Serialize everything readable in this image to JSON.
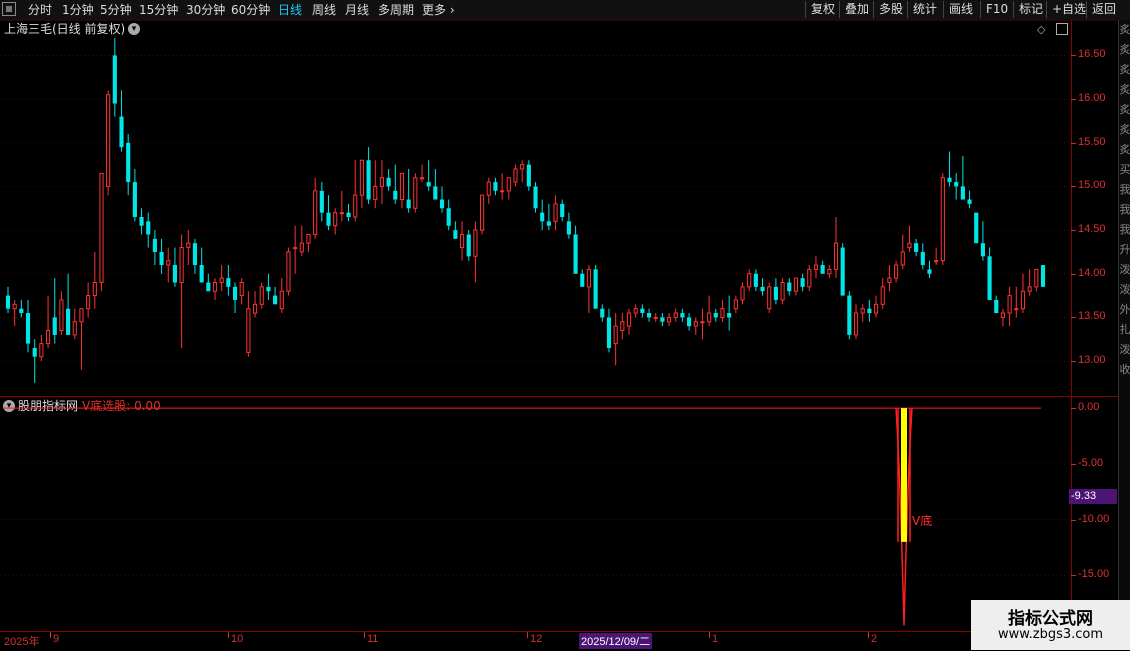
{
  "toolbar": {
    "periods": [
      "分时",
      "1分钟",
      "5分钟",
      "15分钟",
      "30分钟",
      "60分钟",
      "日线",
      "周线",
      "月线",
      "多周期",
      "更多"
    ],
    "active_period": "日线",
    "tools": [
      "复权",
      "叠加",
      "多股",
      "统计",
      "画线",
      "F10",
      "标记",
      "+自选",
      "返回"
    ]
  },
  "main_chart": {
    "title": "上海三毛(日线 前复权)",
    "y_labels": [
      "16.50",
      "16.00",
      "15.50",
      "15.00",
      "14.50",
      "14.00",
      "13.50",
      "13.00"
    ]
  },
  "sidebar_chars": [
    "炙",
    "炙",
    "炙",
    "炙",
    "炙",
    "炙",
    "炙",
    "买",
    "我",
    "我",
    "我",
    "升",
    "泼",
    "泼",
    "外",
    "扎",
    "泼",
    "收"
  ],
  "indicator": {
    "name": "股朋指标网",
    "series_label": "V底选股: 0.00",
    "y_labels": [
      "0.00",
      "-5.00",
      "-10.00",
      "-15.00"
    ],
    "current_badge": "-9.33",
    "annotation": "V底"
  },
  "x_axis": {
    "labels": [
      "2025年",
      "9",
      "10",
      "11",
      "12",
      "2025/12/09/二",
      "1",
      "2"
    ],
    "selected": "2025/12/09/二"
  },
  "watermark": {
    "line1": "指标公式网",
    "line2": "www.zbgs3.com"
  },
  "colors": {
    "up": "#ff3232",
    "down": "#00e5e5",
    "grid": "#5a0000",
    "indicator_line": "#ff2020",
    "indicator_fill": "#ffff00"
  },
  "chart_data": {
    "type": "candlestick",
    "ylim": [
      12.6,
      16.7
    ],
    "indicator_ylim": [
      -20,
      1
    ],
    "candles": [
      [
        13.75,
        13.85,
        13.55,
        13.6
      ],
      [
        13.6,
        13.7,
        13.4,
        13.65
      ],
      [
        13.6,
        13.7,
        13.5,
        13.55
      ],
      [
        13.55,
        13.7,
        13.1,
        13.2
      ],
      [
        13.15,
        13.25,
        12.75,
        13.05
      ],
      [
        13.05,
        13.3,
        13.0,
        13.2
      ],
      [
        13.2,
        13.75,
        13.15,
        13.35
      ],
      [
        13.5,
        13.95,
        13.2,
        13.3
      ],
      [
        13.35,
        13.8,
        13.3,
        13.7
      ],
      [
        13.6,
        14.0,
        13.3,
        13.3
      ],
      [
        13.3,
        13.6,
        13.25,
        13.45
      ],
      [
        13.45,
        13.6,
        12.9,
        13.6
      ],
      [
        13.6,
        13.9,
        13.5,
        13.75
      ],
      [
        13.75,
        14.25,
        13.6,
        13.9
      ],
      [
        13.9,
        15.15,
        13.8,
        15.15
      ],
      [
        15.0,
        16.1,
        14.9,
        16.05
      ],
      [
        16.5,
        16.7,
        15.8,
        15.95
      ],
      [
        15.8,
        16.1,
        15.4,
        15.45
      ],
      [
        15.5,
        15.6,
        14.9,
        15.05
      ],
      [
        15.05,
        15.2,
        14.6,
        14.65
      ],
      [
        14.65,
        14.75,
        14.45,
        14.55
      ],
      [
        14.6,
        14.7,
        14.3,
        14.45
      ],
      [
        14.4,
        14.5,
        14.1,
        14.25
      ],
      [
        14.25,
        14.4,
        14.0,
        14.1
      ],
      [
        14.1,
        14.3,
        13.9,
        14.15
      ],
      [
        14.1,
        14.3,
        13.85,
        13.9
      ],
      [
        13.9,
        14.45,
        13.15,
        14.3
      ],
      [
        14.3,
        14.5,
        14.1,
        14.35
      ],
      [
        14.35,
        14.4,
        14.0,
        14.1
      ],
      [
        14.1,
        14.3,
        13.9,
        13.9
      ],
      [
        13.9,
        14.0,
        13.8,
        13.8
      ],
      [
        13.8,
        13.95,
        13.7,
        13.9
      ],
      [
        13.9,
        14.1,
        13.8,
        13.95
      ],
      [
        13.95,
        14.1,
        13.75,
        13.85
      ],
      [
        13.85,
        13.9,
        13.55,
        13.7
      ],
      [
        13.75,
        13.95,
        13.65,
        13.9
      ],
      [
        13.1,
        13.8,
        13.05,
        13.6
      ],
      [
        13.55,
        13.8,
        13.5,
        13.65
      ],
      [
        13.65,
        13.9,
        13.6,
        13.85
      ],
      [
        13.85,
        14.0,
        13.7,
        13.8
      ],
      [
        13.75,
        13.85,
        13.65,
        13.65
      ],
      [
        13.6,
        13.95,
        13.55,
        13.8
      ],
      [
        13.8,
        14.3,
        13.75,
        14.25
      ],
      [
        14.3,
        14.55,
        14.0,
        14.3
      ],
      [
        14.25,
        14.55,
        14.2,
        14.35
      ],
      [
        14.35,
        14.45,
        14.25,
        14.45
      ],
      [
        14.45,
        15.1,
        14.4,
        14.95
      ],
      [
        14.95,
        15.05,
        14.6,
        14.7
      ],
      [
        14.7,
        14.9,
        14.5,
        14.55
      ],
      [
        14.55,
        14.75,
        14.45,
        14.7
      ],
      [
        14.7,
        14.95,
        14.6,
        14.7
      ],
      [
        14.7,
        14.8,
        14.6,
        14.65
      ],
      [
        14.65,
        15.3,
        14.6,
        14.9
      ],
      [
        14.9,
        15.3,
        14.75,
        15.3
      ],
      [
        15.3,
        15.45,
        14.8,
        14.85
      ],
      [
        14.85,
        15.3,
        14.75,
        15.0
      ],
      [
        15.0,
        15.3,
        14.8,
        15.1
      ],
      [
        15.1,
        15.2,
        14.95,
        15.0
      ],
      [
        14.95,
        15.25,
        14.8,
        14.85
      ],
      [
        14.85,
        15.15,
        14.75,
        15.15
      ],
      [
        14.85,
        15.2,
        14.7,
        14.75
      ],
      [
        14.75,
        15.15,
        14.7,
        15.1
      ],
      [
        15.1,
        15.25,
        15.05,
        15.1
      ],
      [
        15.05,
        15.3,
        14.95,
        15.0
      ],
      [
        15.0,
        15.2,
        14.85,
        14.85
      ],
      [
        14.85,
        15.0,
        14.7,
        14.75
      ],
      [
        14.75,
        14.85,
        14.5,
        14.55
      ],
      [
        14.5,
        14.6,
        14.4,
        14.4
      ],
      [
        14.3,
        14.6,
        14.15,
        14.45
      ],
      [
        14.45,
        14.5,
        14.15,
        14.2
      ],
      [
        14.2,
        14.6,
        13.9,
        14.5
      ],
      [
        14.5,
        14.9,
        14.45,
        14.9
      ],
      [
        14.9,
        15.1,
        14.8,
        15.05
      ],
      [
        15.05,
        15.1,
        14.9,
        14.95
      ],
      [
        14.95,
        15.15,
        14.85,
        14.95
      ],
      [
        14.95,
        15.1,
        14.85,
        15.1
      ],
      [
        15.05,
        15.25,
        15.0,
        15.2
      ],
      [
        15.2,
        15.3,
        15.05,
        15.25
      ],
      [
        15.25,
        15.3,
        14.95,
        15.0
      ],
      [
        15.0,
        15.05,
        14.7,
        14.75
      ],
      [
        14.7,
        14.85,
        14.5,
        14.6
      ],
      [
        14.6,
        14.8,
        14.5,
        14.55
      ],
      [
        14.6,
        14.9,
        14.5,
        14.8
      ],
      [
        14.8,
        14.85,
        14.6,
        14.65
      ],
      [
        14.6,
        14.7,
        14.4,
        14.45
      ],
      [
        14.45,
        14.55,
        14.0,
        14.0
      ],
      [
        14.0,
        14.05,
        13.85,
        13.85
      ],
      [
        13.85,
        14.1,
        13.55,
        14.05
      ],
      [
        14.05,
        14.1,
        13.6,
        13.6
      ],
      [
        13.6,
        13.65,
        13.45,
        13.5
      ],
      [
        13.5,
        13.6,
        13.1,
        13.15
      ],
      [
        13.2,
        13.55,
        12.95,
        13.4
      ],
      [
        13.35,
        13.55,
        13.25,
        13.45
      ],
      [
        13.4,
        13.6,
        13.3,
        13.55
      ],
      [
        13.55,
        13.65,
        13.5,
        13.6
      ],
      [
        13.6,
        13.65,
        13.5,
        13.55
      ],
      [
        13.55,
        13.6,
        13.45,
        13.5
      ],
      [
        13.5,
        13.55,
        13.45,
        13.5
      ],
      [
        13.5,
        13.55,
        13.4,
        13.45
      ],
      [
        13.45,
        13.55,
        13.4,
        13.5
      ],
      [
        13.5,
        13.6,
        13.45,
        13.55
      ],
      [
        13.55,
        13.6,
        13.45,
        13.5
      ],
      [
        13.5,
        13.55,
        13.35,
        13.4
      ],
      [
        13.4,
        13.5,
        13.3,
        13.45
      ],
      [
        13.45,
        13.6,
        13.25,
        13.45
      ],
      [
        13.45,
        13.75,
        13.4,
        13.55
      ],
      [
        13.55,
        13.6,
        13.45,
        13.5
      ],
      [
        13.5,
        13.7,
        13.45,
        13.6
      ],
      [
        13.55,
        13.75,
        13.35,
        13.5
      ],
      [
        13.6,
        13.75,
        13.55,
        13.7
      ],
      [
        13.7,
        13.9,
        13.65,
        13.85
      ],
      [
        13.85,
        14.05,
        13.8,
        14.0
      ],
      [
        14.0,
        14.05,
        13.8,
        13.85
      ],
      [
        13.85,
        13.95,
        13.75,
        13.8
      ],
      [
        13.6,
        13.9,
        13.55,
        13.85
      ],
      [
        13.85,
        13.95,
        13.65,
        13.7
      ],
      [
        13.7,
        13.95,
        13.65,
        13.9
      ],
      [
        13.9,
        13.95,
        13.75,
        13.8
      ],
      [
        13.8,
        13.95,
        13.75,
        13.95
      ],
      [
        13.95,
        14.0,
        13.8,
        13.85
      ],
      [
        13.85,
        14.1,
        13.8,
        14.05
      ],
      [
        14.05,
        14.2,
        13.95,
        14.1
      ],
      [
        14.1,
        14.15,
        14.0,
        14.0
      ],
      [
        14.0,
        14.1,
        13.95,
        14.05
      ],
      [
        14.05,
        14.65,
        13.95,
        14.35
      ],
      [
        14.3,
        14.35,
        13.75,
        13.75
      ],
      [
        13.75,
        13.8,
        13.25,
        13.3
      ],
      [
        13.3,
        13.65,
        13.25,
        13.55
      ],
      [
        13.55,
        13.65,
        13.45,
        13.6
      ],
      [
        13.6,
        13.7,
        13.45,
        13.55
      ],
      [
        13.55,
        13.75,
        13.5,
        13.65
      ],
      [
        13.65,
        13.95,
        13.6,
        13.85
      ],
      [
        13.9,
        14.1,
        13.8,
        13.95
      ],
      [
        13.95,
        14.15,
        13.9,
        14.1
      ],
      [
        14.1,
        14.45,
        14.05,
        14.25
      ],
      [
        14.3,
        14.55,
        14.25,
        14.35
      ],
      [
        14.35,
        14.4,
        14.2,
        14.25
      ],
      [
        14.25,
        14.35,
        14.05,
        14.1
      ],
      [
        14.05,
        14.15,
        13.95,
        14.0
      ],
      [
        14.15,
        14.3,
        14.1,
        14.15
      ],
      [
        14.15,
        15.15,
        14.1,
        15.1
      ],
      [
        15.1,
        15.4,
        15.0,
        15.05
      ],
      [
        15.05,
        15.15,
        14.85,
        15.0
      ],
      [
        15.0,
        15.35,
        14.85,
        14.85
      ],
      [
        14.85,
        14.95,
        14.75,
        14.8
      ],
      [
        14.7,
        14.7,
        14.35,
        14.35
      ],
      [
        14.35,
        14.6,
        14.15,
        14.2
      ],
      [
        14.2,
        14.3,
        13.7,
        13.7
      ],
      [
        13.7,
        13.75,
        13.55,
        13.55
      ],
      [
        13.5,
        13.6,
        13.4,
        13.55
      ],
      [
        13.55,
        13.85,
        13.4,
        13.75
      ],
      [
        13.6,
        13.85,
        13.5,
        13.6
      ],
      [
        13.6,
        14.0,
        13.55,
        13.8
      ],
      [
        13.8,
        14.05,
        13.75,
        13.85
      ],
      [
        13.85,
        14.05,
        13.8,
        14.05
      ],
      [
        14.1,
        14.1,
        13.85,
        13.85
      ]
    ]
  }
}
